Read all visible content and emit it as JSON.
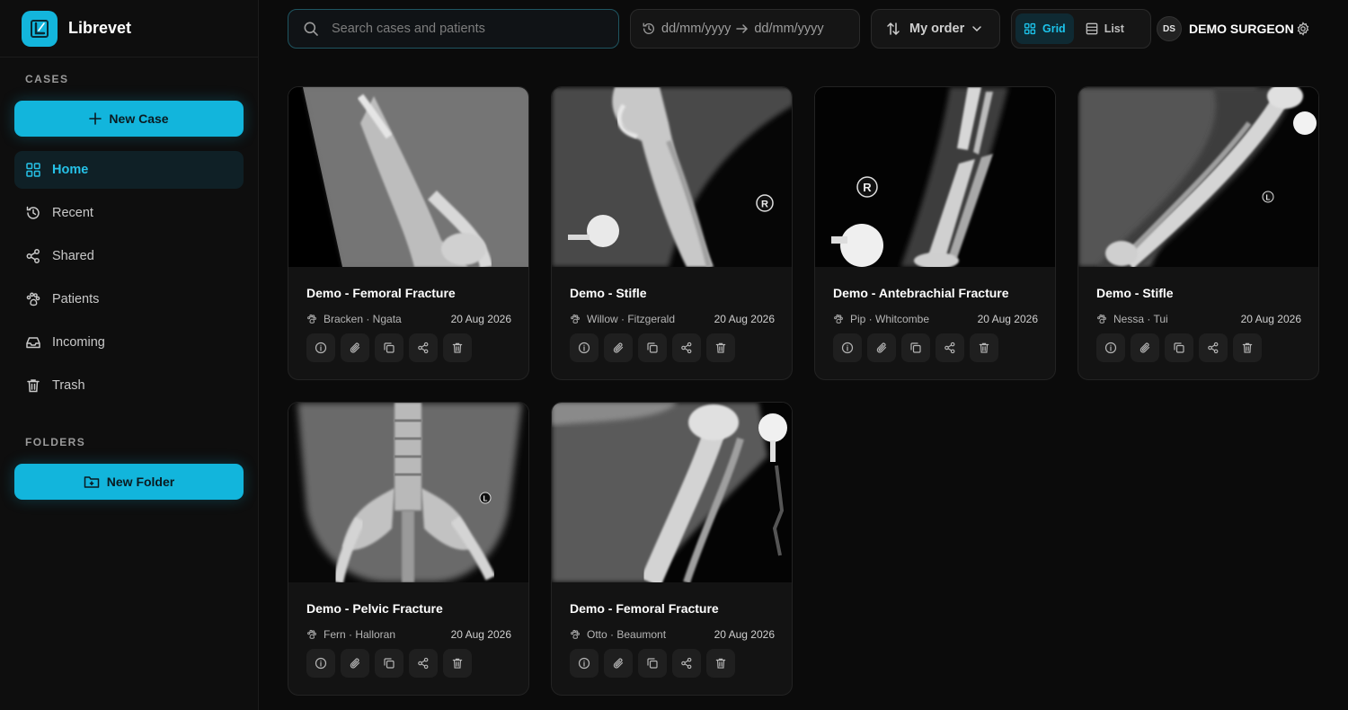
{
  "app": {
    "name": "Librevet"
  },
  "sidebar": {
    "cases_title": "CASES",
    "new_case": "New Case",
    "nav": [
      {
        "label": "Home",
        "icon": "grid-icon"
      },
      {
        "label": "Recent",
        "icon": "history-icon"
      },
      {
        "label": "Shared",
        "icon": "share-icon"
      },
      {
        "label": "Patients",
        "icon": "paw-icon"
      },
      {
        "label": "Incoming",
        "icon": "inbox-icon"
      },
      {
        "label": "Trash",
        "icon": "trash-icon"
      }
    ],
    "folders_title": "FOLDERS",
    "new_folder": "New Folder"
  },
  "topbar": {
    "search_placeholder": "Search cases and patients",
    "date_from": "dd/mm/yyyy",
    "date_to": "dd/mm/yyyy",
    "order_label": "My order",
    "view_grid": "Grid",
    "view_list": "List",
    "user_initials": "DS",
    "user_name": "DEMO SURGEON"
  },
  "colors": {
    "accent": "#12b5dc",
    "background": "#0b0b0b",
    "card": "#131313"
  },
  "cases": [
    {
      "title": "Demo - Femoral Fracture",
      "patient": "Bracken · Ngata",
      "date": "20 Aug 2026"
    },
    {
      "title": "Demo - Stifle",
      "patient": "Willow · Fitzgerald",
      "date": "20 Aug 2026"
    },
    {
      "title": "Demo - Antebrachial Fracture",
      "patient": "Pip · Whitcombe",
      "date": "20 Aug 2026"
    },
    {
      "title": "Demo - Stifle",
      "patient": "Nessa · Tui",
      "date": "20 Aug 2026"
    },
    {
      "title": "Demo - Pelvic Fracture",
      "patient": "Fern · Halloran",
      "date": "20 Aug 2026"
    },
    {
      "title": "Demo - Femoral Fracture",
      "patient": "Otto · Beaumont",
      "date": "20 Aug 2026"
    }
  ],
  "xray_markers": {
    "r": "R",
    "l": "L"
  }
}
